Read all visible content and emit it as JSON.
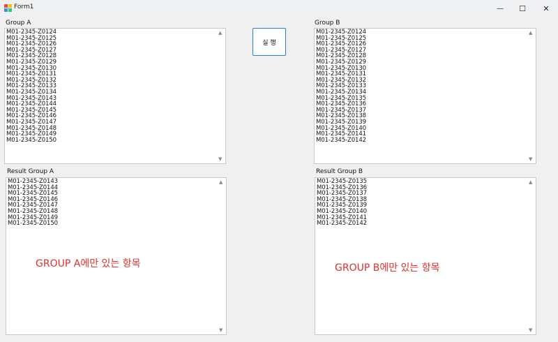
{
  "window": {
    "title": "Form1",
    "minimize_glyph": "—",
    "maximize_glyph": "☐",
    "close_glyph": "✕"
  },
  "run_button": {
    "label": "실 행"
  },
  "group_a": {
    "label": "Group A",
    "items": [
      "M01-2345-Z0124",
      "M01-2345-Z0125",
      "M01-2345-Z0126",
      "M01-2345-Z0127",
      "M01-2345-Z0128",
      "M01-2345-Z0129",
      "M01-2345-Z0130",
      "M01-2345-Z0131",
      "M01-2345-Z0132",
      "M01-2345-Z0133",
      "M01-2345-Z0134",
      "M01-2345-Z0143",
      "M01-2345-Z0144",
      "M01-2345-Z0145",
      "M01-2345-Z0146",
      "M01-2345-Z0147",
      "M01-2345-Z0148",
      "M01-2345-Z0149",
      "M01-2345-Z0150"
    ]
  },
  "group_b": {
    "label": "Group B",
    "items": [
      "M01-2345-Z0124",
      "M01-2345-Z0125",
      "M01-2345-Z0126",
      "M01-2345-Z0127",
      "M01-2345-Z0128",
      "M01-2345-Z0129",
      "M01-2345-Z0130",
      "M01-2345-Z0131",
      "M01-2345-Z0132",
      "M01-2345-Z0133",
      "M01-2345-Z0134",
      "M01-2345-Z0135",
      "M01-2345-Z0136",
      "M01-2345-Z0137",
      "M01-2345-Z0138",
      "M01-2345-Z0139",
      "M01-2345-Z0140",
      "M01-2345-Z0141",
      "M01-2345-Z0142"
    ]
  },
  "result_a": {
    "label": "Result Group A",
    "items": [
      "M01-2345-Z0143",
      "M01-2345-Z0144",
      "M01-2345-Z0145",
      "M01-2345-Z0146",
      "M01-2345-Z0147",
      "M01-2345-Z0148",
      "M01-2345-Z0149",
      "M01-2345-Z0150"
    ],
    "annotation": "GROUP A에만 있는 항목"
  },
  "result_b": {
    "label": "Result Group B",
    "items": [
      "M01-2345-Z0135",
      "M01-2345-Z0136",
      "M01-2345-Z0137",
      "M01-2345-Z0138",
      "M01-2345-Z0139",
      "M01-2345-Z0140",
      "M01-2345-Z0141",
      "M01-2345-Z0142"
    ],
    "annotation": "GROUP B에만 있는 항목"
  },
  "scroll_glyphs": {
    "up": "▲",
    "down": "▼"
  },
  "colors": {
    "annotation": "#e0302c",
    "button_border": "#2a7fd4"
  }
}
